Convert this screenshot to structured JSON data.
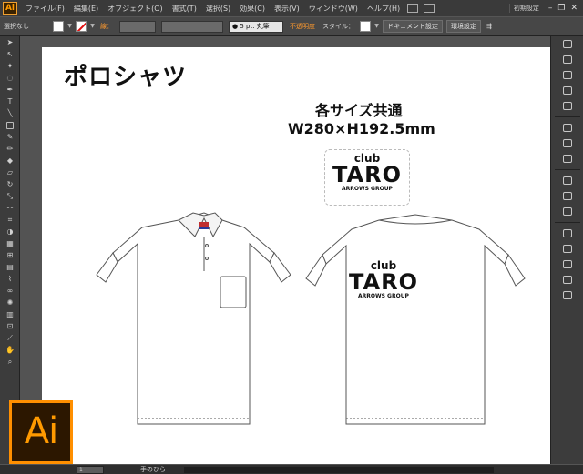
{
  "app": {
    "logo_text": "Ai",
    "workspace": "初期設定"
  },
  "menu": [
    "ファイル(F)",
    "編集(E)",
    "オブジェクト(O)",
    "書式(T)",
    "選択(S)",
    "効果(C)",
    "表示(V)",
    "ウィンドウ(W)",
    "ヘルプ(H)"
  ],
  "control": {
    "selection": "選択なし",
    "stroke_label": "線：",
    "brush": "● 5 pt. 丸筆",
    "opacity_label": "不透明度",
    "style_label": "スタイル：",
    "doc_settings": "ドキュメント設定",
    "preferences": "環境設定"
  },
  "artboard": {
    "title": "ポロシャツ",
    "size_line1": "各サイズ共通",
    "size_line2": "W280×H192.5mm"
  },
  "logo": {
    "club": "club",
    "taro": "TARO",
    "arrows": "ARROWS GROUP"
  },
  "status": {
    "zoom": "1",
    "tool": "手のひら"
  },
  "badge": "Ai",
  "colors": {
    "accent": "#ff9a00",
    "ui_dark": "#323232",
    "artboard": "#ffffff"
  }
}
